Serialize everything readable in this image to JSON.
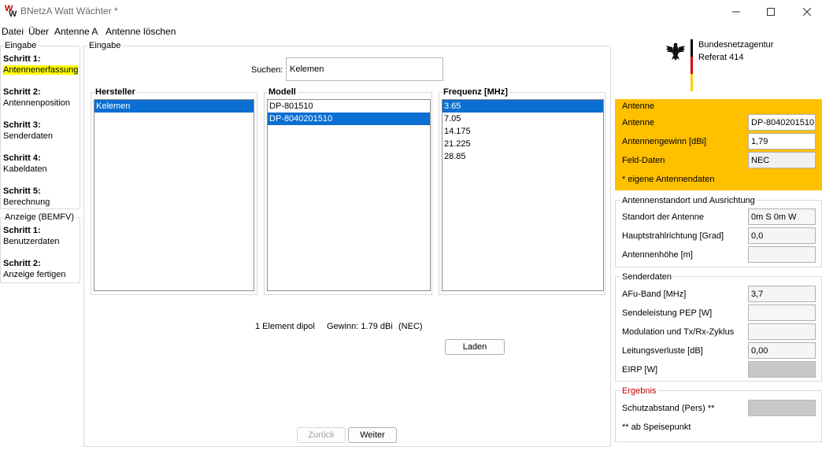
{
  "window": {
    "title": "BNetzA Watt Wächter *"
  },
  "menu": [
    "Datei",
    "Über",
    "Antenne A",
    "Antenne löschen"
  ],
  "nav": {
    "eingabe_legend": "Eingabe",
    "eingabe_steps": [
      {
        "head": "Schritt 1:",
        "sub": "Antennenerfassung"
      },
      {
        "head": "Schritt 2:",
        "sub": "Antennenposition"
      },
      {
        "head": "Schritt 3:",
        "sub": "Senderdaten"
      },
      {
        "head": "Schritt 4:",
        "sub": "Kabeldaten"
      },
      {
        "head": "Schritt 5:",
        "sub": "Berechnung"
      }
    ],
    "anzeige_legend": "Anzeige (BEMFV)",
    "anzeige_steps": [
      {
        "head": "Schritt 1:",
        "sub": "Benutzerdaten"
      },
      {
        "head": "Schritt 2:",
        "sub": "Anzeige fertigen"
      }
    ]
  },
  "main": {
    "legend": "Eingabe",
    "search_label": "Suchen:",
    "search_value": "Kelemen",
    "lists": {
      "hersteller": {
        "title": "Hersteller",
        "items": [
          "Kelemen"
        ]
      },
      "modell": {
        "title": "Modell",
        "items": [
          "DP-801510",
          "DP-8040201510"
        ]
      },
      "frequenz": {
        "title": "Frequenz [MHz]",
        "items": [
          "3.65",
          "7.05",
          "14.175",
          "21.225",
          "28.85"
        ]
      }
    },
    "info": {
      "description": "1 Element dipol",
      "gain": "Gewinn:  1.79 dBi",
      "source": "(NEC)"
    },
    "load_button": "Laden",
    "back_button": "Zurück",
    "next_button": "Weiter"
  },
  "logo": {
    "line1": "Bundesnetzagentur",
    "line2": "Referat 414"
  },
  "antenne": {
    "title": "Antenne",
    "rows": [
      {
        "label": "Antenne",
        "value": "DP-8040201510"
      },
      {
        "label": "Antennengewinn [dBi]",
        "value": "1,79"
      },
      {
        "label": "Feld-Daten",
        "value": "NEC"
      }
    ],
    "note": "* eigene Antennendaten",
    "bg_color": "#ffc000"
  },
  "standort": {
    "title": "Antennenstandort und Ausrichtung",
    "rows": [
      {
        "label": "Standort der Antenne",
        "value": "0m S 0m W"
      },
      {
        "label": "Hauptstrahlrichtung [Grad]",
        "value": "0,0"
      },
      {
        "label": "Antennenhöhe [m]",
        "value": ""
      }
    ]
  },
  "sender": {
    "title": "Senderdaten",
    "rows": [
      {
        "label": "AFu-Band [MHz]",
        "value": "3,7"
      },
      {
        "label": "Sendeleistung PEP [W]",
        "value": ""
      },
      {
        "label": "Modulation und Tx/Rx-Zyklus",
        "value": ""
      },
      {
        "label": "Leitungsverluste [dB]",
        "value": "0,00"
      },
      {
        "label": "EIRP [W]",
        "value": ""
      }
    ]
  },
  "ergebnis": {
    "title": "Ergebnis",
    "title_color": "#c00000",
    "rows": [
      {
        "label": "Schutzabstand (Pers) **",
        "value": ""
      }
    ],
    "note": "** ab Speisepunkt"
  },
  "colors": {
    "selection": "#0a6fd1",
    "highlight": "#ffff00"
  }
}
